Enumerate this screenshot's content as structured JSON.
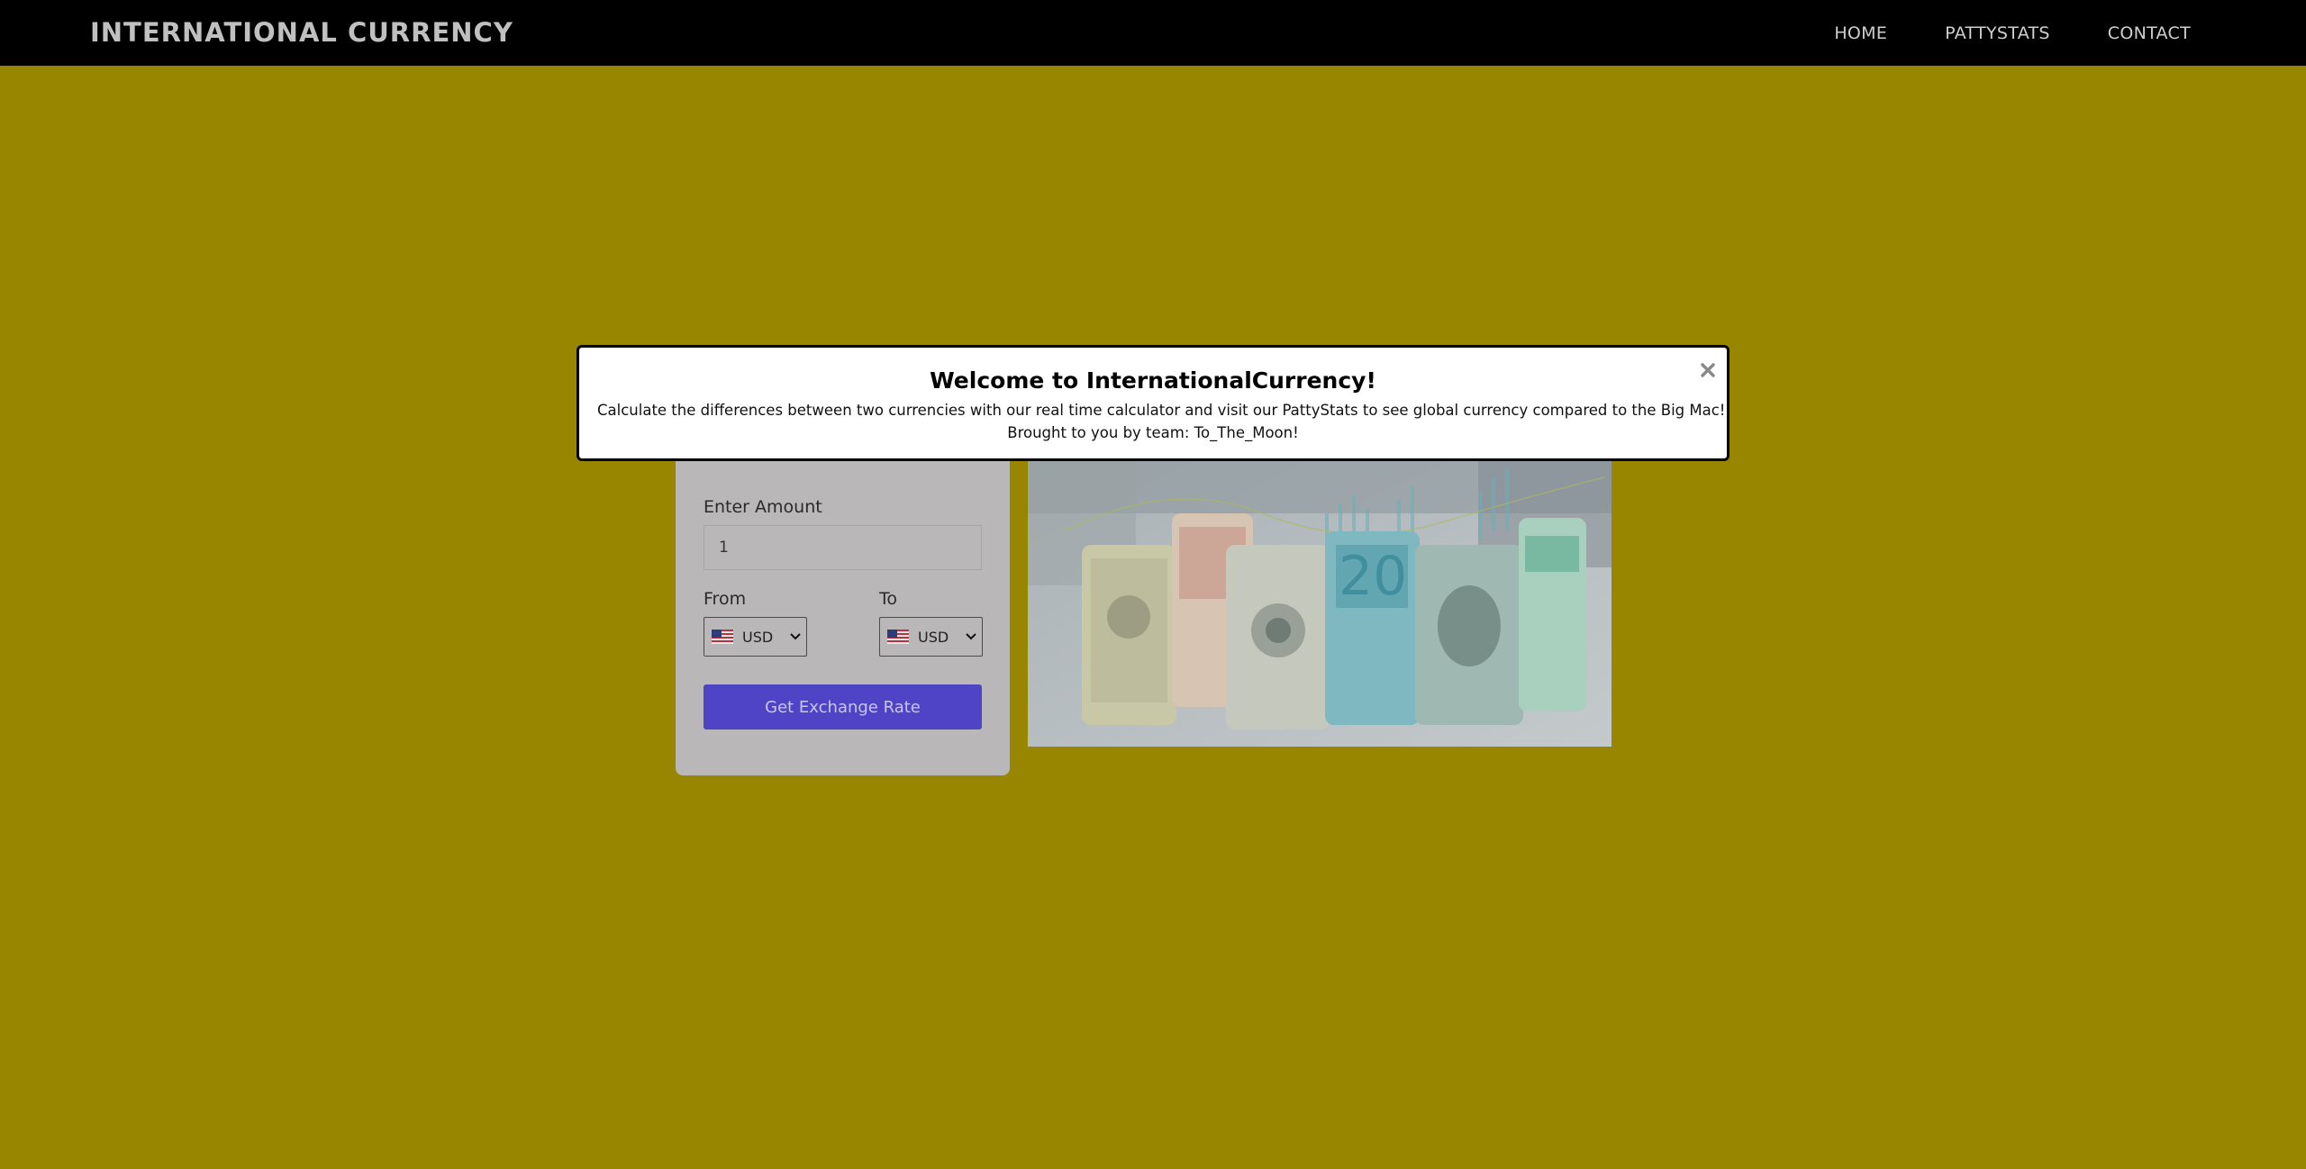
{
  "header": {
    "brand": "INTERNATIONAL CURRENCY",
    "nav": [
      {
        "label": "HOME"
      },
      {
        "label": "PATTYSTATS"
      },
      {
        "label": "CONTACT"
      }
    ]
  },
  "converter": {
    "amount_label": "Enter Amount",
    "amount_value": "1",
    "from_label": "From",
    "to_label": "To",
    "from_currency": "USD",
    "to_currency": "USD",
    "flag_icon": "us-flag-icon",
    "button_label": "Get Exchange Rate"
  },
  "hero_image": {
    "description_icon": "banknote-rolls-image"
  },
  "modal": {
    "title": "Welcome to InternationalCurrency!",
    "line1": "Calculate the differences between two currencies with our real time calculator and visit our PattyStats to see global currency compared to the Big Mac!",
    "line2": "Brought to you by team: To_The_Moon!",
    "close_icon": "close-icon"
  },
  "colors": {
    "page_background": "#988600",
    "navbar": "#000000",
    "card": "#b9b7b7",
    "button": "#4f43c6",
    "modal_border": "#000000"
  }
}
